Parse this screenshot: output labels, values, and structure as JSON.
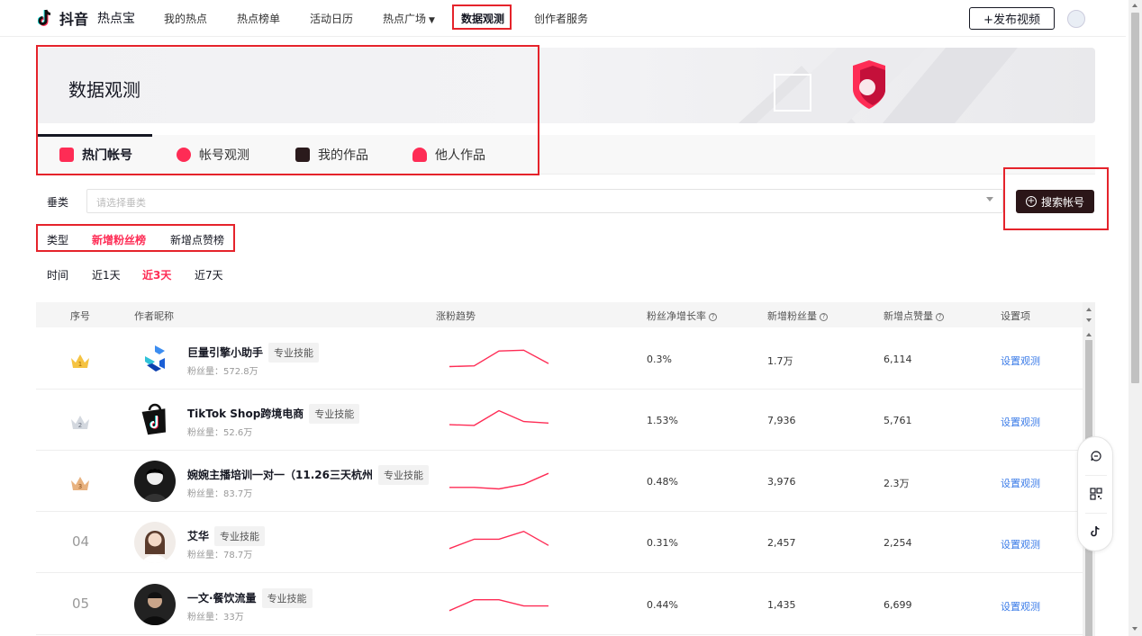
{
  "topnav": {
    "logo_text": "抖音",
    "logo_sub": "热点宝",
    "items": [
      {
        "label": "我的热点"
      },
      {
        "label": "热点榜单"
      },
      {
        "label": "活动日历"
      },
      {
        "label": "热点广场"
      },
      {
        "label": "数据观测"
      },
      {
        "label": "创作者服务"
      }
    ],
    "publish_label": "+发布视频"
  },
  "banner": {
    "title": "数据观测"
  },
  "tabs": [
    {
      "label": "热门帐号"
    },
    {
      "label": "帐号观测"
    },
    {
      "label": "我的作品"
    },
    {
      "label": "他人作品"
    }
  ],
  "filters": {
    "category_label": "垂类",
    "category_placeholder": "请选择垂类",
    "search_button": "搜索帐号",
    "type_label": "类型",
    "type_options": [
      "新增粉丝榜",
      "新增点赞榜"
    ],
    "type_selected": "新增粉丝榜",
    "time_label": "时间",
    "time_options": [
      "近1天",
      "近3天",
      "近7天"
    ],
    "time_selected": "近3天"
  },
  "table": {
    "headers": {
      "rank": "序号",
      "author": "作者昵称",
      "trend": "涨粉趋势",
      "growth": "粉丝净增长率",
      "new_fans": "新增粉丝量",
      "new_likes": "新增点赞量",
      "settings": "设置项"
    },
    "rows": [
      {
        "rank": "",
        "name": "巨量引擎小助手",
        "tag": "专业技能",
        "fans": "粉丝量：572.8万",
        "growth": "0.3%",
        "new_fans": "1.7万",
        "new_likes": "6,114",
        "action": "设置观测",
        "trend": [
          2,
          2.5,
          12,
          12.5,
          4
        ]
      },
      {
        "rank": "",
        "name": "TikTok Shop跨境电商",
        "tag": "专业技能",
        "fans": "粉丝量：52.6万",
        "growth": "1.53%",
        "new_fans": "7,936",
        "new_likes": "5,761",
        "action": "设置观测",
        "trend": [
          4,
          3.5,
          13,
          6,
          5
        ]
      },
      {
        "rank": "",
        "name": "婉婉主播培训一对一（11.26三天杭州",
        "tag": "专业技能",
        "fans": "粉丝量：83.7万",
        "growth": "0.48%",
        "new_fans": "3,976",
        "new_likes": "2.3万",
        "action": "设置观测",
        "trend": [
          3,
          3,
          2,
          5,
          12
        ]
      },
      {
        "rank": "04",
        "name": "艾华",
        "tag": "专业技能",
        "fans": "粉丝量：78.7万",
        "growth": "0.31%",
        "new_fans": "2,457",
        "new_likes": "2,254",
        "action": "设置观测",
        "trend": [
          3,
          9,
          9,
          14,
          5
        ]
      },
      {
        "rank": "05",
        "name": "一文·餐饮流量",
        "tag": "专业技能",
        "fans": "粉丝量：33万",
        "growth": "0.44%",
        "new_fans": "1,435",
        "new_likes": "6,699",
        "action": "设置观测",
        "trend": [
          3,
          10,
          10,
          6,
          6
        ]
      }
    ]
  }
}
